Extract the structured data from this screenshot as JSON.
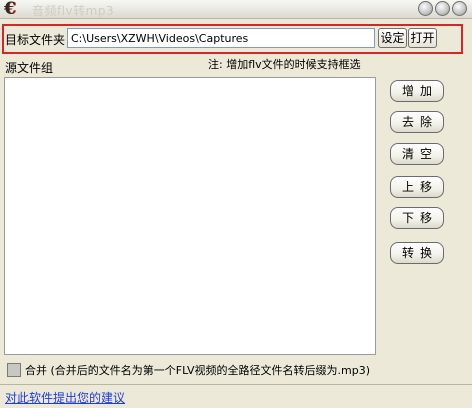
{
  "window": {
    "title": "音频flv转mp3",
    "icons": {
      "app": "app-icon",
      "minimize": "minimize-icon",
      "maximize": "maximize-icon",
      "close": "close-icon"
    }
  },
  "target_folder": {
    "label": "目标文件夹",
    "value": "C:\\Users\\XZWH\\Videos\\Captures",
    "set_label": "设定",
    "open_label": "打开"
  },
  "note": "注: 增加flv文件的时候支持框选",
  "source_group": {
    "label": "源文件组",
    "items": []
  },
  "actions": {
    "add": "增加",
    "remove": "去除",
    "clear": "清空",
    "move_up": "上移",
    "move_down": "下移",
    "convert": "转换"
  },
  "merge": {
    "checked": false,
    "label": "合并 (合并后的文件名为第一个FLV视频的全路径文件名转后缀为.mp3)"
  },
  "feedback_link": "对此软件提出您的建议",
  "colors": {
    "highlight_border": "#d6262c",
    "link": "#1f3cd6",
    "window_bg": "#ece9d8"
  }
}
